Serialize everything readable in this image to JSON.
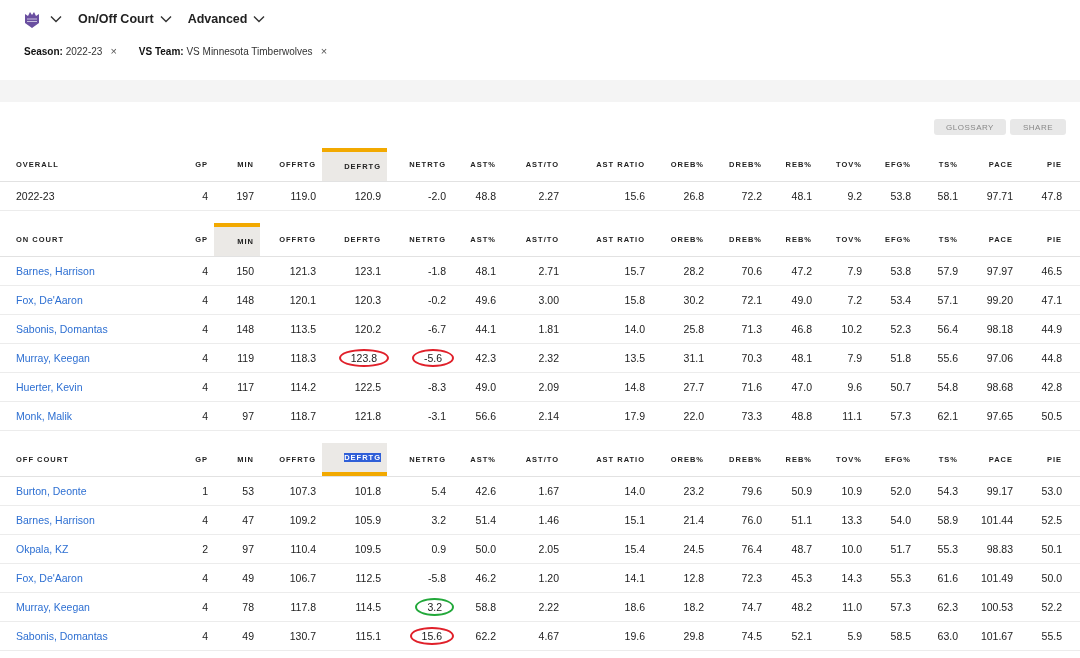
{
  "nav": {
    "dropdowns": [
      {
        "label": "On/Off Court"
      },
      {
        "label": "Advanced"
      }
    ]
  },
  "filters": [
    {
      "label": "Season:",
      "value": "2022-23",
      "remove": "×"
    },
    {
      "label": "VS Team:",
      "value": "VS Minnesota Timberwolves",
      "remove": "×"
    }
  ],
  "actions": [
    "GLOSSARY",
    "SHARE"
  ],
  "tables": [
    {
      "bar_below": false,
      "columns": [
        {
          "label": "OVERALL",
          "selected": false,
          "text_selected": false
        },
        {
          "label": "GP",
          "selected": false,
          "text_selected": false
        },
        {
          "label": "MIN",
          "selected": false,
          "text_selected": false
        },
        {
          "label": "OFFRTG",
          "selected": false,
          "text_selected": false
        },
        {
          "label": "DEFRTG",
          "selected": true,
          "text_selected": false
        },
        {
          "label": "NETRTG",
          "selected": false,
          "text_selected": false
        },
        {
          "label": "AST%",
          "selected": false,
          "text_selected": false
        },
        {
          "label": "AST/TO",
          "selected": false,
          "text_selected": false
        },
        {
          "label": "AST RATIO",
          "selected": false,
          "text_selected": false
        },
        {
          "label": "OREB%",
          "selected": false,
          "text_selected": false
        },
        {
          "label": "DREB%",
          "selected": false,
          "text_selected": false
        },
        {
          "label": "REB%",
          "selected": false,
          "text_selected": false
        },
        {
          "label": "TOV%",
          "selected": false,
          "text_selected": false
        },
        {
          "label": "EFG%",
          "selected": false,
          "text_selected": false
        },
        {
          "label": "TS%",
          "selected": false,
          "text_selected": false
        },
        {
          "label": "PACE",
          "selected": false,
          "text_selected": false
        },
        {
          "label": "PIE",
          "selected": false,
          "text_selected": false
        }
      ],
      "rows": [
        {
          "kind": "season",
          "cells": [
            "2022-23",
            "4",
            "197",
            "119.0",
            "120.9",
            "-2.0",
            "48.8",
            "2.27",
            "15.6",
            "26.8",
            "72.2",
            "48.1",
            "9.2",
            "53.8",
            "58.1",
            "97.71",
            "47.8"
          ]
        }
      ]
    },
    {
      "bar_below": false,
      "columns": [
        {
          "label": "ON COURT",
          "selected": false,
          "text_selected": false
        },
        {
          "label": "GP",
          "selected": false,
          "text_selected": false
        },
        {
          "label": "MIN",
          "selected": true,
          "text_selected": false
        },
        {
          "label": "OFFRTG",
          "selected": false,
          "text_selected": false
        },
        {
          "label": "DEFRTG",
          "selected": false,
          "text_selected": false
        },
        {
          "label": "NETRTG",
          "selected": false,
          "text_selected": false
        },
        {
          "label": "AST%",
          "selected": false,
          "text_selected": false
        },
        {
          "label": "AST/TO",
          "selected": false,
          "text_selected": false
        },
        {
          "label": "AST RATIO",
          "selected": false,
          "text_selected": false
        },
        {
          "label": "OREB%",
          "selected": false,
          "text_selected": false
        },
        {
          "label": "DREB%",
          "selected": false,
          "text_selected": false
        },
        {
          "label": "REB%",
          "selected": false,
          "text_selected": false
        },
        {
          "label": "TOV%",
          "selected": false,
          "text_selected": false
        },
        {
          "label": "EFG%",
          "selected": false,
          "text_selected": false
        },
        {
          "label": "TS%",
          "selected": false,
          "text_selected": false
        },
        {
          "label": "PACE",
          "selected": false,
          "text_selected": false
        },
        {
          "label": "PIE",
          "selected": false,
          "text_selected": false
        }
      ],
      "rows": [
        {
          "kind": "player",
          "cells": [
            "Barnes, Harrison",
            "4",
            "150",
            "121.3",
            "123.1",
            "-1.8",
            "48.1",
            "2.71",
            "15.7",
            "28.2",
            "70.6",
            "47.2",
            "7.9",
            "53.8",
            "57.9",
            "97.97",
            "46.5"
          ]
        },
        {
          "kind": "player",
          "cells": [
            "Fox, De'Aaron",
            "4",
            "148",
            "120.1",
            "120.3",
            "-0.2",
            "49.6",
            "3.00",
            "15.8",
            "30.2",
            "72.1",
            "49.0",
            "7.2",
            "53.4",
            "57.1",
            "99.20",
            "47.1"
          ]
        },
        {
          "kind": "player",
          "cells": [
            "Sabonis, Domantas",
            "4",
            "148",
            "113.5",
            "120.2",
            "-6.7",
            "44.1",
            "1.81",
            "14.0",
            "25.8",
            "71.3",
            "46.8",
            "10.2",
            "52.3",
            "56.4",
            "98.18",
            "44.9"
          ]
        },
        {
          "kind": "player",
          "cells": [
            "Murray, Keegan",
            "4",
            "119",
            "118.3",
            {
              "text": "123.8",
              "color": "#e0202a"
            },
            {
              "text": "-5.6",
              "color": "#e0202a"
            },
            "42.3",
            "2.32",
            "13.5",
            "31.1",
            "70.3",
            "48.1",
            "7.9",
            "51.8",
            "55.6",
            "97.06",
            "44.8"
          ]
        },
        {
          "kind": "player",
          "cells": [
            "Huerter, Kevin",
            "4",
            "117",
            "114.2",
            "122.5",
            "-8.3",
            "49.0",
            "2.09",
            "14.8",
            "27.7",
            "71.6",
            "47.0",
            "9.6",
            "50.7",
            "54.8",
            "98.68",
            "42.8"
          ]
        },
        {
          "kind": "player",
          "cells": [
            "Monk, Malik",
            "4",
            "97",
            "118.7",
            "121.8",
            "-3.1",
            "56.6",
            "2.14",
            "17.9",
            "22.0",
            "73.3",
            "48.8",
            "11.1",
            "57.3",
            "62.1",
            "97.65",
            "50.5"
          ]
        }
      ]
    },
    {
      "bar_below": true,
      "columns": [
        {
          "label": "OFF COURT",
          "selected": false,
          "text_selected": false
        },
        {
          "label": "GP",
          "selected": false,
          "text_selected": false
        },
        {
          "label": "MIN",
          "selected": false,
          "text_selected": false
        },
        {
          "label": "OFFRTG",
          "selected": false,
          "text_selected": false
        },
        {
          "label": "DEFRTG",
          "selected": true,
          "text_selected": true
        },
        {
          "label": "NETRTG",
          "selected": false,
          "text_selected": false
        },
        {
          "label": "AST%",
          "selected": false,
          "text_selected": false
        },
        {
          "label": "AST/TO",
          "selected": false,
          "text_selected": false
        },
        {
          "label": "AST RATIO",
          "selected": false,
          "text_selected": false
        },
        {
          "label": "OREB%",
          "selected": false,
          "text_selected": false
        },
        {
          "label": "DREB%",
          "selected": false,
          "text_selected": false
        },
        {
          "label": "REB%",
          "selected": false,
          "text_selected": false
        },
        {
          "label": "TOV%",
          "selected": false,
          "text_selected": false
        },
        {
          "label": "EFG%",
          "selected": false,
          "text_selected": false
        },
        {
          "label": "TS%",
          "selected": false,
          "text_selected": false
        },
        {
          "label": "PACE",
          "selected": false,
          "text_selected": false
        },
        {
          "label": "PIE",
          "selected": false,
          "text_selected": false
        }
      ],
      "rows": [
        {
          "kind": "player",
          "cells": [
            "Burton, Deonte",
            "1",
            "53",
            "107.3",
            "101.8",
            "5.4",
            "42.6",
            "1.67",
            "14.0",
            "23.2",
            "79.6",
            "50.9",
            "10.9",
            "52.0",
            "54.3",
            "99.17",
            "53.0"
          ]
        },
        {
          "kind": "player",
          "cells": [
            "Barnes, Harrison",
            "4",
            "47",
            "109.2",
            "105.9",
            "3.2",
            "51.4",
            "1.46",
            "15.1",
            "21.4",
            "76.0",
            "51.1",
            "13.3",
            "54.0",
            "58.9",
            "101.44",
            "52.5"
          ]
        },
        {
          "kind": "player",
          "cells": [
            "Okpala, KZ",
            "2",
            "97",
            "110.4",
            "109.5",
            "0.9",
            "50.0",
            "2.05",
            "15.4",
            "24.5",
            "76.4",
            "48.7",
            "10.0",
            "51.7",
            "55.3",
            "98.83",
            "50.1"
          ]
        },
        {
          "kind": "player",
          "cells": [
            "Fox, De'Aaron",
            "4",
            "49",
            "106.7",
            "112.5",
            "-5.8",
            "46.2",
            "1.20",
            "14.1",
            "12.8",
            "72.3",
            "45.3",
            "14.3",
            "55.3",
            "61.6",
            "101.49",
            "50.0"
          ]
        },
        {
          "kind": "player",
          "cells": [
            "Murray, Keegan",
            "4",
            "78",
            "117.8",
            "114.5",
            {
              "text": "3.2",
              "color": "#22a83a"
            },
            "58.8",
            "2.22",
            "18.6",
            "18.2",
            "74.7",
            "48.2",
            "11.0",
            "57.3",
            "62.3",
            "100.53",
            "52.2"
          ]
        },
        {
          "kind": "player",
          "cells": [
            "Sabonis, Domantas",
            "4",
            "49",
            "130.7",
            "115.1",
            {
              "text": "15.6",
              "color": "#e0202a"
            },
            "62.2",
            "4.67",
            "19.6",
            "29.8",
            "74.5",
            "52.1",
            "5.9",
            "58.5",
            "63.0",
            "101.67",
            "55.5"
          ]
        }
      ]
    }
  ]
}
